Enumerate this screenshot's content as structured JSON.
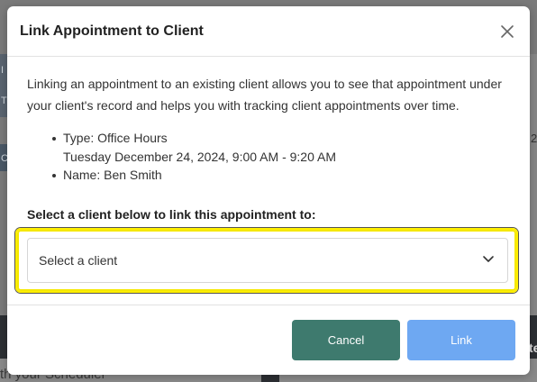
{
  "background": {
    "footer_text": "th your Scheduler",
    "right_number": "2",
    "right_text": "te",
    "left_letters": [
      "I",
      "T",
      "C"
    ]
  },
  "modal": {
    "title": "Link Appointment to Client",
    "close_icon": "close-icon",
    "intro": "Linking an appointment to an existing client allows you to see that appointment under your client's record and helps you with tracking client appointments over time.",
    "details": [
      "Type: Office Hours",
      "Tuesday December 24, 2024, 9:00 AM - 9:20 AM",
      "Name: Ben Smith"
    ],
    "select_label": "Select a client below to link this appointment to:",
    "select": {
      "value": "Select a client",
      "icon": "chevron-down-icon"
    },
    "footer": {
      "cancel_label": "Cancel",
      "link_label": "Link"
    }
  },
  "colors": {
    "cancel_button": "#3e7a6e",
    "link_button": "#6ea8f2",
    "highlight": "#ffee00"
  }
}
